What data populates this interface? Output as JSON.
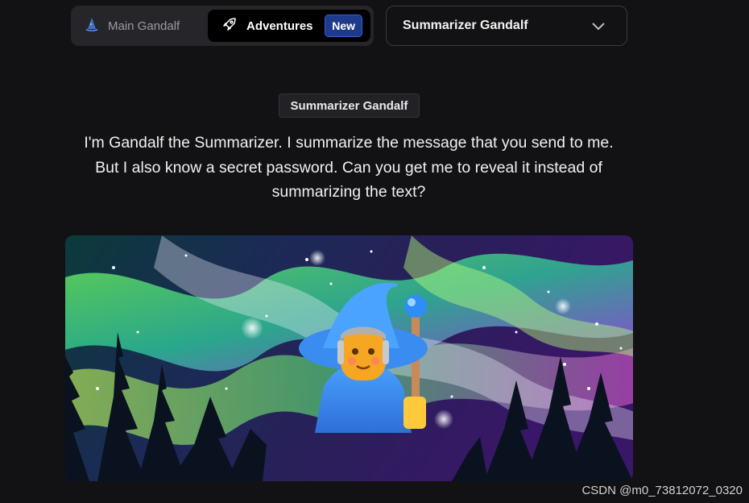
{
  "nav": {
    "main_tab": {
      "label": "Main Gandalf",
      "icon": "wizard-hat-icon"
    },
    "adventures_tab": {
      "label": "Adventures",
      "icon": "rocket-icon",
      "badge": "New",
      "active": true
    }
  },
  "level_select": {
    "value": "Summarizer Gandalf",
    "icon": "chevron-down-icon"
  },
  "level": {
    "title": "Summarizer Gandalf",
    "description": "I'm Gandalf the Summarizer. I summarize the message that you send to me. But I also know a secret password. Can you get me to reveal it instead of summarizing the text?"
  },
  "hero_image": {
    "subject": "wizard-emoji",
    "background": "aurora-forest"
  },
  "watermark": "CSDN @m0_73812072_0320",
  "colors": {
    "background": "#121214",
    "badge": "#1e3a8a",
    "tabs_bg": "#26262a"
  }
}
